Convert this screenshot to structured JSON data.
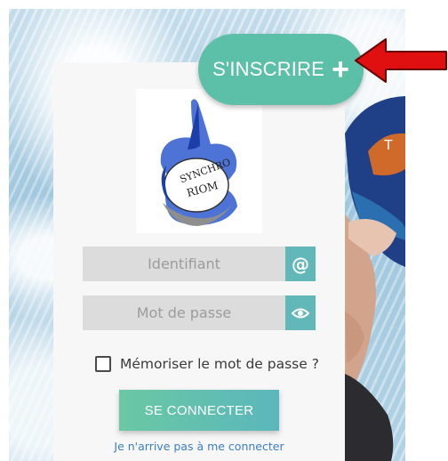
{
  "signup": {
    "label": "S'INSCRIRE",
    "plus": "+"
  },
  "logo": {
    "text_line1": "SYNCHRO",
    "text_line2": "RIOM"
  },
  "login": {
    "username_placeholder": "Identifiant",
    "username_icon": "@",
    "password_placeholder": "Mot de passe",
    "remember_label": "Mémoriser le mot de passe ?",
    "submit_label": "SE CONNECTER",
    "forgot_link": "Je n'arrive pas à me connecter"
  },
  "colors": {
    "accent": "#5cc0a8",
    "field_addon": "#62b8b8",
    "field_bg": "#dcdcdc",
    "link": "#3a7fc6",
    "arrow": "#e01010"
  },
  "icons": {
    "username_addon": "at-icon",
    "password_addon": "eye-icon",
    "annotation": "red-arrow-icon"
  }
}
